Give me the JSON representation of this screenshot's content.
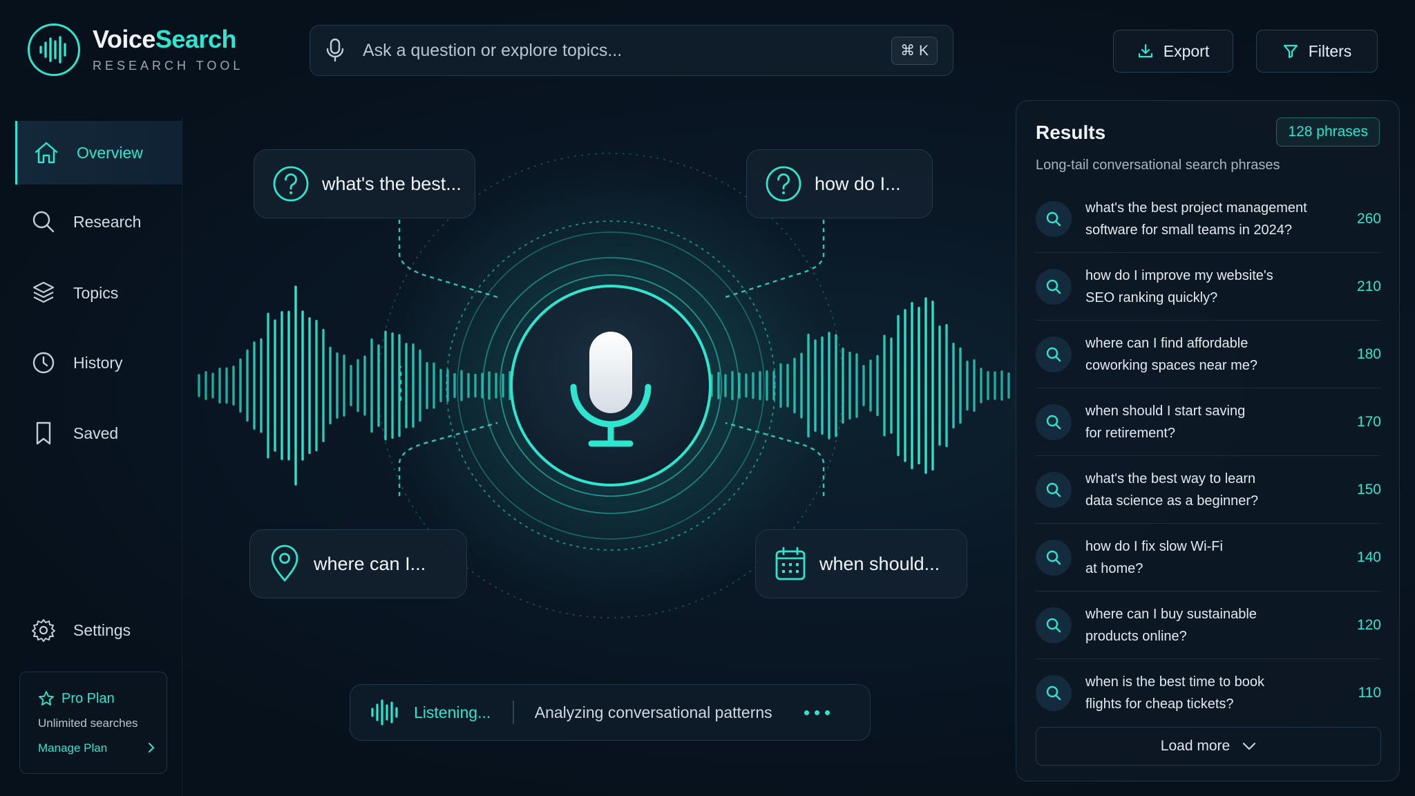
{
  "app": {
    "name_part1": "Voice",
    "name_part2": "Search",
    "subtitle": "RESEARCH TOOL"
  },
  "search": {
    "placeholder": "Ask a question or explore topics...",
    "shortcut": "⌘ K"
  },
  "toolbar": {
    "export_label": "Export",
    "filters_label": "Filters"
  },
  "sidebar": {
    "items": [
      {
        "label": "Overview",
        "icon": "home-icon",
        "active": true
      },
      {
        "label": "Research",
        "icon": "search-icon"
      },
      {
        "label": "Topics",
        "icon": "layers-icon"
      },
      {
        "label": "History",
        "icon": "clock-icon"
      },
      {
        "label": "Saved",
        "icon": "bookmark-icon"
      }
    ],
    "settings_label": "Settings",
    "plan": {
      "title": "Pro Plan",
      "description": "Unlimited searches",
      "link": "Manage Plan"
    }
  },
  "visual": {
    "bubbles": [
      {
        "text": "what's the best...",
        "icon": "question-icon"
      },
      {
        "text": "how do I...",
        "icon": "question-icon"
      },
      {
        "text": "where can I...",
        "icon": "location-pin-icon"
      },
      {
        "text": "when should...",
        "icon": "calendar-icon"
      }
    ],
    "accent_color": "#2ee6d0"
  },
  "status": {
    "listening": "Listening...",
    "message": "Analyzing conversational patterns"
  },
  "results": {
    "title": "Results",
    "count_badge": "128 phrases",
    "subtitle": "Long-tail conversational search phrases",
    "rows": [
      {
        "line1": "what's the best project management",
        "line2": "software for small teams in 2024?",
        "value": "260"
      },
      {
        "line1": "how do I improve my website's",
        "line2": "SEO ranking quickly?",
        "value": "210"
      },
      {
        "line1": "where can I find affordable",
        "line2": "coworking spaces near me?",
        "value": "180"
      },
      {
        "line1": "when should I start saving",
        "line2": "for retirement?",
        "value": "170"
      },
      {
        "line1": "what's the best way to learn",
        "line2": "data science as a beginner?",
        "value": "150"
      },
      {
        "line1": "how do I fix slow Wi-Fi",
        "line2": "at home?",
        "value": "140"
      },
      {
        "line1": "where can I buy sustainable",
        "line2": "products online?",
        "value": "120"
      },
      {
        "line1": "when is the best time to book",
        "line2": "flights for cheap tickets?",
        "value": "110"
      }
    ],
    "load_more": "Load more"
  }
}
